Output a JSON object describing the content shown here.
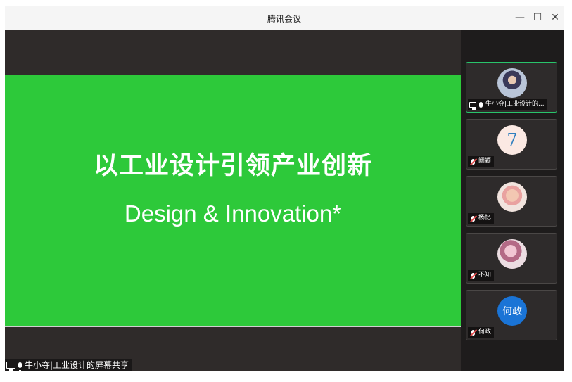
{
  "window": {
    "title": "腾讯会议"
  },
  "titlebar": {
    "minimize": "—",
    "maximize": "☐",
    "close": "✕"
  },
  "slide": {
    "title": "以工业设计引领产业创新",
    "subtitle": "Design & Innovation*",
    "background": "#2dc93a"
  },
  "share_label": {
    "text": "牛小夺|工业设计的屏幕共享"
  },
  "participants": [
    {
      "name": "牛小夺|工业设计的...",
      "avatar": "photo",
      "sharing": true,
      "muted": false,
      "active": true
    },
    {
      "name": "阚颖",
      "avatar_text": "7",
      "sharing": false,
      "muted": true
    },
    {
      "name": "杨忆",
      "avatar": "photo",
      "sharing": false,
      "muted": true
    },
    {
      "name": "不知",
      "avatar": "photo",
      "sharing": false,
      "muted": true
    },
    {
      "name": "何政",
      "avatar_text": "何政",
      "sharing": false,
      "muted": true
    }
  ],
  "colors": {
    "accent_active": "#29c46b",
    "muted_red": "#e34b4b",
    "avatar_blue": "#1a74d6"
  }
}
